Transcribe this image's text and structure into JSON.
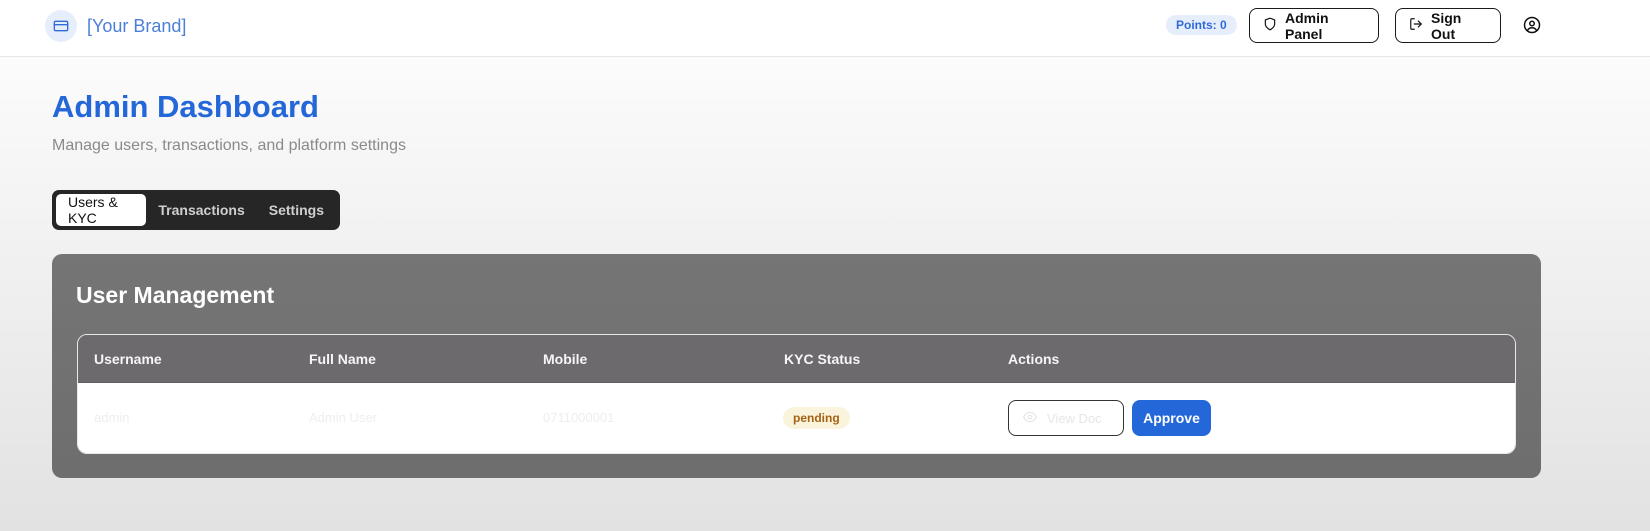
{
  "header": {
    "brand_name": "[Your Brand]",
    "points_label": "Points: 0",
    "admin_panel_label": "Admin Panel",
    "sign_out_label": "Sign Out"
  },
  "page": {
    "title": "Admin Dashboard",
    "subtitle": "Manage users, transactions, and platform settings"
  },
  "tabs": [
    {
      "label": "Users & KYC",
      "active": true
    },
    {
      "label": "Transactions",
      "active": false
    },
    {
      "label": "Settings",
      "active": false
    }
  ],
  "user_management": {
    "title": "User Management",
    "columns": [
      "Username",
      "Full Name",
      "Mobile",
      "KYC Status",
      "Actions"
    ],
    "rows": [
      {
        "username": "admin",
        "full_name": "Admin User",
        "mobile": "0711000001",
        "kyc_status": "pending",
        "view_doc_label": "View Doc",
        "approve_label": "Approve"
      }
    ]
  },
  "colors": {
    "accent": "#2467d8",
    "pending_badge_bg": "#fbf4dc",
    "pending_badge_text": "#a46312"
  },
  "icons": {
    "brand": "credit-card-icon",
    "admin_panel": "shield-icon",
    "sign_out": "log-out-icon",
    "user": "user-circle-icon",
    "view_doc": "eye-icon"
  }
}
